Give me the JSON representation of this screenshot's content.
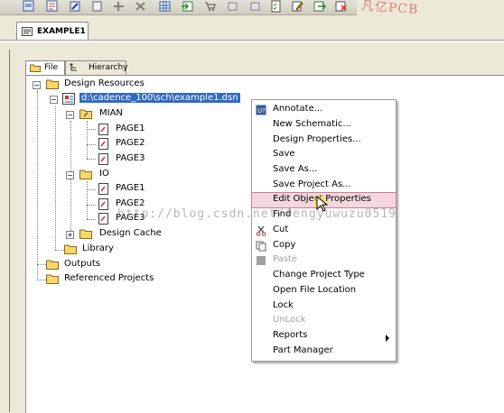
{
  "brand": "凡亿PCB",
  "document_tab": {
    "title": "EXAMPLE1"
  },
  "panel_tabs": [
    {
      "label": "File"
    },
    {
      "label": "Hierarchy"
    }
  ],
  "tree": {
    "design_resources": "Design Resources",
    "design_file": "d:\\cadence_100\\sch\\example1.dsn",
    "mian": "MIAN",
    "mian_pages": [
      "PAGE1",
      "PAGE2",
      "PAGE3"
    ],
    "io": "IO",
    "io_pages": [
      "PAGE1",
      "PAGE2",
      "PAGE3"
    ],
    "design_cache": "Design Cache",
    "library": "Library",
    "outputs": "Outputs",
    "referenced_projects": "Referenced Projects"
  },
  "context_menu": {
    "items": [
      {
        "label": "Annotate..."
      },
      {
        "label": "New Schematic..."
      },
      {
        "label": "Design Properties..."
      },
      {
        "label": "Save"
      },
      {
        "label": "Save As..."
      },
      {
        "label": "Save Project As..."
      },
      {
        "label": "Edit Object Properties"
      },
      {
        "label": "Find"
      },
      {
        "label": "Cut"
      },
      {
        "label": "Copy"
      },
      {
        "label": "Paste"
      },
      {
        "label": "Change Project Type"
      },
      {
        "label": "Open File Location"
      },
      {
        "label": "Lock"
      },
      {
        "label": "UnLock"
      },
      {
        "label": "Reports"
      },
      {
        "label": "Part Manager"
      }
    ],
    "highlighted": "Edit Object Properties",
    "disabled": [
      "Paste",
      "UnLock"
    ],
    "submenu": [
      "Reports"
    ]
  },
  "watermark": "http://blog.csdn.net/fengyuwuzu0519",
  "colors": {
    "selection": "#316ac5",
    "menu_highlight": "#f4d7de",
    "folder": "#f5d76e"
  }
}
